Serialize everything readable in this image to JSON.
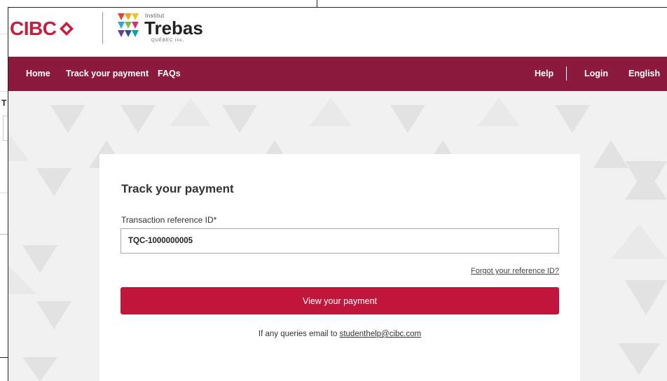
{
  "header": {
    "bank_logo_text": "CIBC",
    "partner_logo": {
      "small_text": "Institut",
      "name": "Trebas",
      "sub_text": "QUÉBEC inc."
    }
  },
  "nav": {
    "home": "Home",
    "track": "Track your payment",
    "faqs": "FAQs",
    "help": "Help",
    "login": "Login",
    "language": "English"
  },
  "form": {
    "title": "Track your payment",
    "field_label": "Transaction reference ID*",
    "field_value": "TQC-1000000005",
    "forgot_link": "Forgot your reference ID?",
    "submit_label": "View your payment",
    "queries_text": "If any queries email to",
    "email": "studenthelp@cibc.com"
  },
  "background_window": {
    "letter": "T"
  },
  "colors": {
    "brand_red": "#c41f3e",
    "nav_background": "#8b1a3e",
    "button_background": "#c1163c"
  }
}
